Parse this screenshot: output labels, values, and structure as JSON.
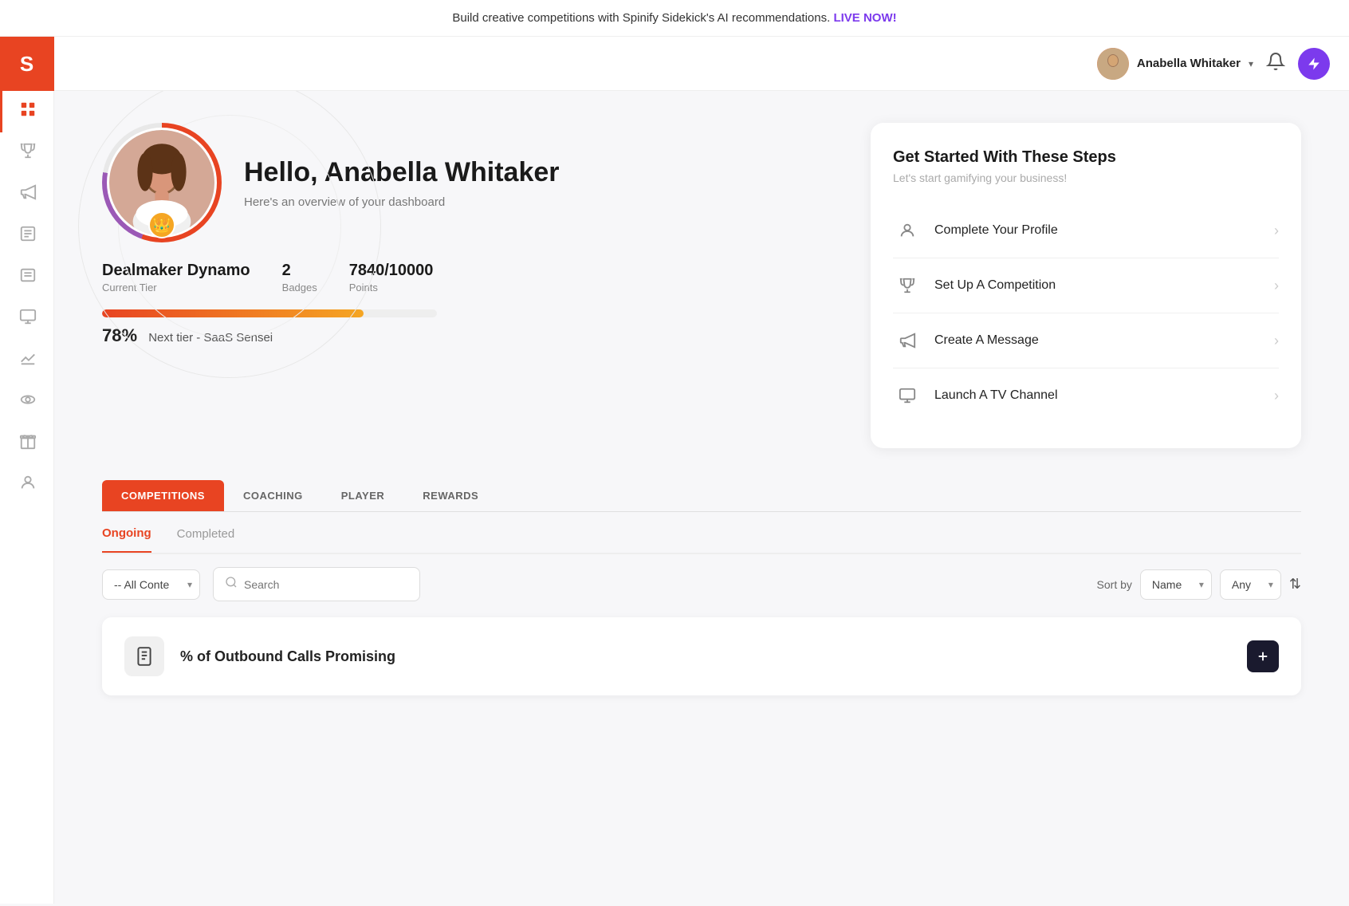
{
  "banner": {
    "text": "Build creative competitions with Spinify Sidekick's AI recommendations.",
    "live_now": "LIVE NOW!"
  },
  "header": {
    "user_name": "Anabella Whitaker",
    "chevron": "▾",
    "bell": "🔔",
    "lightning": "⚡"
  },
  "sidebar": {
    "logo": "S",
    "icons": [
      {
        "name": "dashboard-icon",
        "symbol": "📊",
        "active": true
      },
      {
        "name": "trophy-icon",
        "symbol": "🏆",
        "active": false
      },
      {
        "name": "megaphone-icon",
        "symbol": "📣",
        "active": false
      },
      {
        "name": "newspaper-icon",
        "symbol": "📰",
        "active": false
      },
      {
        "name": "list-icon",
        "symbol": "☰",
        "active": false
      },
      {
        "name": "monitor-icon",
        "symbol": "🖥",
        "active": false
      },
      {
        "name": "chart-icon",
        "symbol": "📈",
        "active": false
      },
      {
        "name": "eye-icon",
        "symbol": "👁",
        "active": false
      },
      {
        "name": "gift-icon",
        "symbol": "🎁",
        "active": false
      },
      {
        "name": "user-icon",
        "symbol": "👤",
        "active": false
      }
    ]
  },
  "profile": {
    "greeting": "Hello, Anabella Whitaker",
    "subtitle": "Here's an overview of your dashboard",
    "tier": "Dealmaker Dynamo",
    "tier_label": "Current Tier",
    "badges": "2",
    "badges_label": "Badges",
    "points": "7840/10000",
    "points_label": "Points",
    "progress_pct": "78%",
    "progress_pct_value": 78,
    "next_tier_text": "Next tier - SaaS Sensei",
    "crown": "👑"
  },
  "get_started": {
    "title": "Get Started With These Steps",
    "subtitle": "Let's start gamifying your business!",
    "steps": [
      {
        "id": "complete-profile",
        "icon": "👤",
        "label": "Complete Your Profile",
        "chevron": "›"
      },
      {
        "id": "setup-competition",
        "icon": "🏆",
        "label": "Set Up A Competition",
        "chevron": "›"
      },
      {
        "id": "create-message",
        "icon": "📣",
        "label": "Create A Message",
        "chevron": "›"
      },
      {
        "id": "launch-tv",
        "icon": "🖥",
        "label": "Launch A TV Channel",
        "chevron": "›"
      }
    ]
  },
  "tabs": {
    "items": [
      {
        "id": "competitions",
        "label": "COMPETITIONS",
        "active": true
      },
      {
        "id": "coaching",
        "label": "COACHING",
        "active": false
      },
      {
        "id": "player",
        "label": "PLAYER",
        "active": false
      },
      {
        "id": "rewards",
        "label": "REWARDS",
        "active": false
      }
    ]
  },
  "sub_tabs": {
    "items": [
      {
        "id": "ongoing",
        "label": "Ongoing",
        "active": true
      },
      {
        "id": "completed",
        "label": "Completed",
        "active": false
      }
    ]
  },
  "filters": {
    "content_placeholder": "-- All Conte",
    "search_placeholder": "Search",
    "sort_label": "Sort by",
    "sort_options": [
      "Name"
    ],
    "any_options": [
      "Any"
    ],
    "sort_icon": "⇅"
  },
  "competitions": [
    {
      "id": "outbound-calls",
      "icon": "📞",
      "title": "% of Outbound Calls Promising"
    }
  ]
}
